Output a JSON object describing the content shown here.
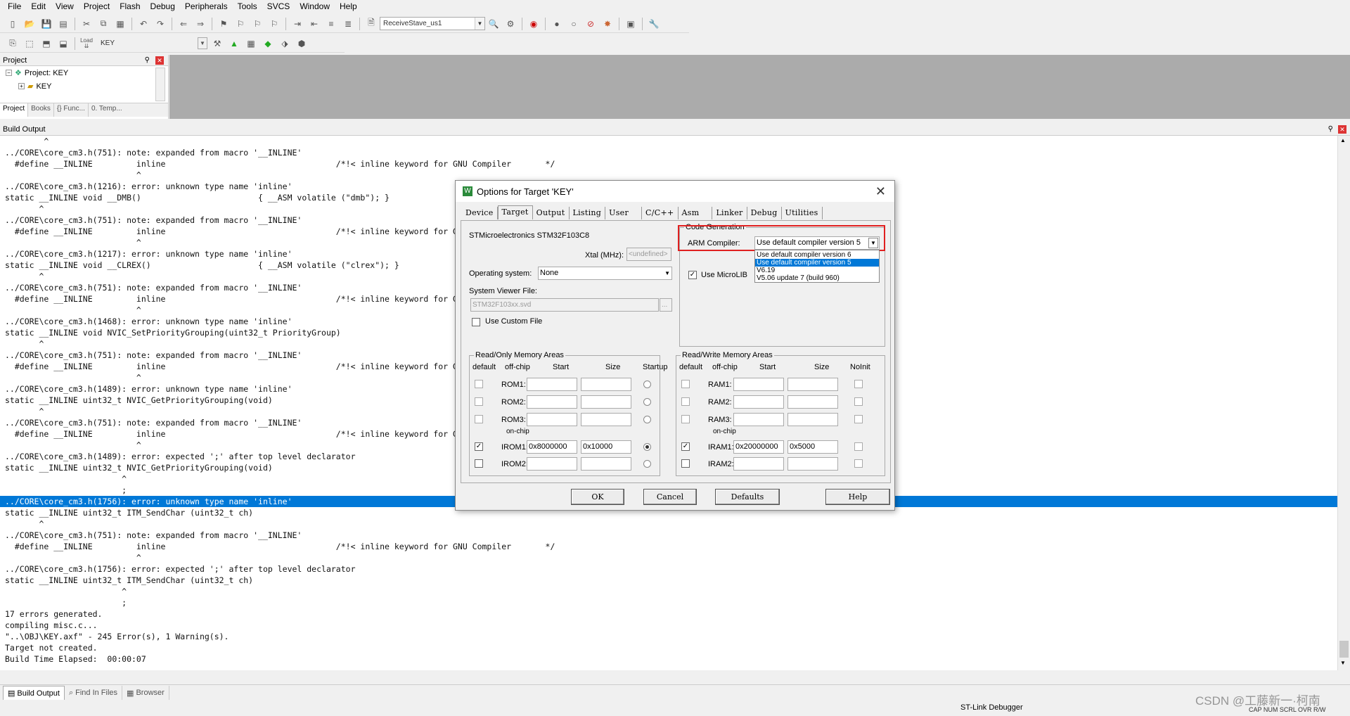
{
  "menu": [
    "File",
    "Edit",
    "View",
    "Project",
    "Flash",
    "Debug",
    "Peripherals",
    "Tools",
    "SVCS",
    "Window",
    "Help"
  ],
  "toolbar1": {
    "target_combo": "ReceiveStave_us1"
  },
  "toolbar2": {
    "target_name": "KEY",
    "load_label": "Load"
  },
  "project_panel": {
    "title": "Project",
    "tree": [
      {
        "label": "Project: KEY"
      },
      {
        "label": "KEY"
      }
    ],
    "tabs": [
      "Project",
      "Books",
      "{} Func...",
      "0. Temp..."
    ]
  },
  "build_output": {
    "title": "Build Output",
    "lines": [
      "        ^",
      "../CORE\\core_cm3.h(751): note: expanded from macro '__INLINE'",
      "  #define __INLINE         inline                                   /*!< inline keyword for GNU Compiler       */",
      "                           ^",
      "../CORE\\core_cm3.h(1216): error: unknown type name 'inline'",
      "static __INLINE void __DMB()                        { __ASM volatile (\"dmb\"); }",
      "       ^",
      "../CORE\\core_cm3.h(751): note: expanded from macro '__INLINE'",
      "  #define __INLINE         inline                                   /*!< inline keyword for GNU Compiler       */",
      "                           ^",
      "../CORE\\core_cm3.h(1217): error: unknown type name 'inline'",
      "static __INLINE void __CLREX()                      { __ASM volatile (\"clrex\"); }",
      "       ^",
      "../CORE\\core_cm3.h(751): note: expanded from macro '__INLINE'",
      "  #define __INLINE         inline                                   /*!< inline keyword for GNU Compiler       */",
      "                           ^",
      "../CORE\\core_cm3.h(1468): error: unknown type name 'inline'",
      "static __INLINE void NVIC_SetPriorityGrouping(uint32_t PriorityGroup)",
      "       ^",
      "../CORE\\core_cm3.h(751): note: expanded from macro '__INLINE'",
      "  #define __INLINE         inline                                   /*!< inline keyword for GNU Compiler       */",
      "                           ^",
      "../CORE\\core_cm3.h(1489): error: unknown type name 'inline'",
      "static __INLINE uint32_t NVIC_GetPriorityGrouping(void)",
      "       ^",
      "../CORE\\core_cm3.h(751): note: expanded from macro '__INLINE'",
      "  #define __INLINE         inline                                   /*!< inline keyword for GNU Compiler       */",
      "                           ^",
      "../CORE\\core_cm3.h(1489): error: expected ';' after top level declarator",
      "static __INLINE uint32_t NVIC_GetPriorityGrouping(void)",
      "                        ^",
      "                        ;",
      "../CORE\\core_cm3.h(1756): error: unknown type name 'inline'",
      "static __INLINE uint32_t ITM_SendChar (uint32_t ch)",
      "       ^",
      "../CORE\\core_cm3.h(751): note: expanded from macro '__INLINE'",
      "  #define __INLINE         inline                                   /*!< inline keyword for GNU Compiler       */",
      "                           ^",
      "../CORE\\core_cm3.h(1756): error: expected ';' after top level declarator",
      "static __INLINE uint32_t ITM_SendChar (uint32_t ch)",
      "                        ^",
      "                        ;",
      "17 errors generated.",
      "compiling misc.c...",
      "\"..\\OBJ\\KEY.axf\" - 245 Error(s), 1 Warning(s).",
      "Target not created.",
      "Build Time Elapsed:  00:00:07"
    ],
    "selected_line": 32
  },
  "bottom_tabs": [
    "Build Output",
    "Find In Files",
    "Browser"
  ],
  "status": {
    "debugger": "ST-Link Debugger",
    "indicators": "CAP  NUM  SCRL  OVR  R/W",
    "watermark": "CSDN @工藤新一·柯南"
  },
  "dialog": {
    "title": "Options for Target 'KEY'",
    "tabs": [
      "Device",
      "Target",
      "Output",
      "Listing",
      "User",
      "C/C++",
      "Asm",
      "Linker",
      "Debug",
      "Utilities"
    ],
    "active_tab": "Target",
    "device": "STMicroelectronics STM32F103C8",
    "xtal_label": "Xtal (MHz):",
    "xtal_value": "<undefined>",
    "os_label": "Operating system:",
    "os_value": "None",
    "svd_label": "System Viewer File:",
    "svd_value": "STM32F103xx.svd",
    "custom_file_label": "Use Custom File",
    "codegen": {
      "group": "Code Generation",
      "compiler_label": "ARM Compiler:",
      "compiler_value": "Use default compiler version 5",
      "options": [
        "Use default compiler version 6",
        "Use default compiler version 5",
        "V6.19",
        "V5.06 update 7 (build 960)"
      ],
      "selected_option": 1,
      "microlib_label": "Use MicroLIB",
      "microlib_checked": true
    },
    "rom": {
      "group": "Read/Only Memory Areas",
      "headers": [
        "default",
        "off-chip",
        "Start",
        "Size",
        "Startup"
      ],
      "onchip_label": "on-chip",
      "rows": [
        {
          "name": "ROM1:",
          "start": "",
          "size": "",
          "default": false,
          "startup": false
        },
        {
          "name": "ROM2:",
          "start": "",
          "size": "",
          "default": false,
          "startup": false
        },
        {
          "name": "ROM3:",
          "start": "",
          "size": "",
          "default": false,
          "startup": false
        },
        {
          "name": "IROM1:",
          "start": "0x8000000",
          "size": "0x10000",
          "default": true,
          "startup": true
        },
        {
          "name": "IROM2:",
          "start": "",
          "size": "",
          "default": false,
          "startup": false
        }
      ]
    },
    "ram": {
      "group": "Read/Write Memory Areas",
      "headers": [
        "default",
        "off-chip",
        "Start",
        "Size",
        "NoInit"
      ],
      "onchip_label": "on-chip",
      "rows": [
        {
          "name": "RAM1:",
          "start": "",
          "size": "",
          "default": false
        },
        {
          "name": "RAM2:",
          "start": "",
          "size": "",
          "default": false
        },
        {
          "name": "RAM3:",
          "start": "",
          "size": "",
          "default": false
        },
        {
          "name": "IRAM1:",
          "start": "0x20000000",
          "size": "0x5000",
          "default": true
        },
        {
          "name": "IRAM2:",
          "start": "",
          "size": "",
          "default": false
        }
      ]
    },
    "buttons": {
      "ok": "OK",
      "cancel": "Cancel",
      "defaults": "Defaults",
      "help": "Help"
    },
    "highlight_color": "#e02020"
  }
}
